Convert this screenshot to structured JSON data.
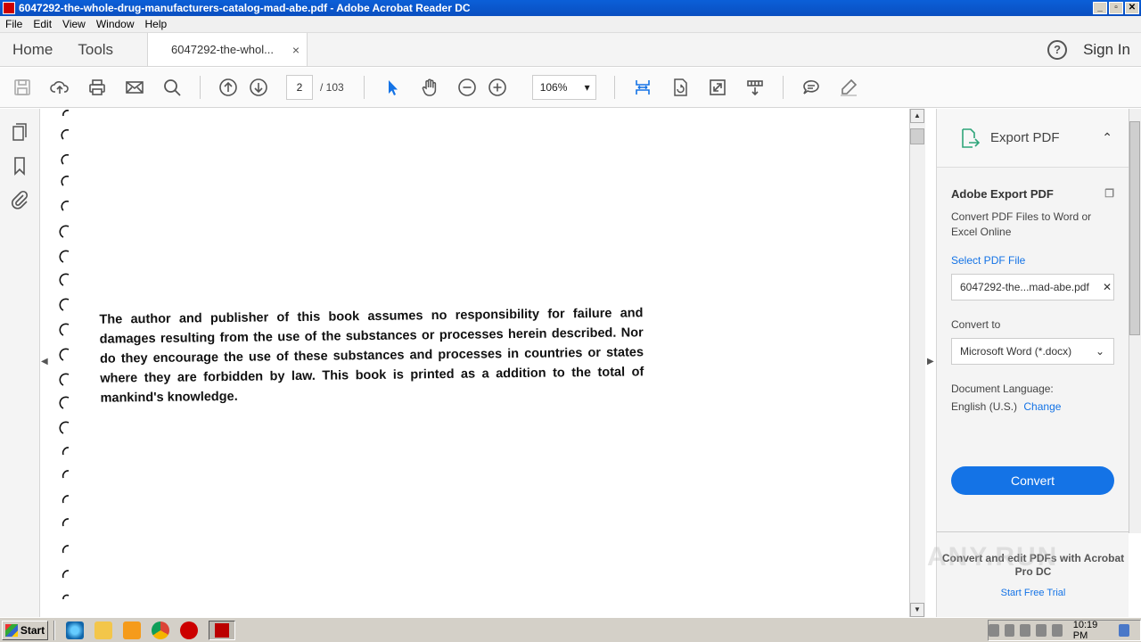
{
  "window": {
    "title": "6047292-the-whole-drug-manufacturers-catalog-mad-abe.pdf - Adobe Acrobat Reader DC",
    "minimize": "_",
    "maximize": "▫",
    "close": "✕"
  },
  "menu": [
    "File",
    "Edit",
    "View",
    "Window",
    "Help"
  ],
  "tabs": {
    "home": "Home",
    "tools": "Tools",
    "document": "6047292-the-whol...",
    "close": "×",
    "help": "?",
    "signin": "Sign In"
  },
  "toolbar": {
    "page_current": "2",
    "page_total": "/ 103",
    "zoom": "106%",
    "zoom_arrow": "▾"
  },
  "document": {
    "disclaimer": "The author and publisher of this book assumes no responsibility for failure and damages resulting from the use of the substances or processes herein described. Nor do they encourage the use of these substances and processes in countries or states where they are forbidden by law. This book is printed as a addition to the total of mankind's knowledge."
  },
  "export_panel": {
    "title": "Export PDF",
    "chevron": "⌃",
    "heading": "Adobe Export PDF",
    "description": "Convert PDF Files to Word or Excel Online",
    "select_link": "Select PDF File",
    "file_name": "6047292-the...mad-abe.pdf",
    "file_clear": "✕",
    "convert_to_label": "Convert to",
    "convert_to_value": "Microsoft Word (*.docx)",
    "convert_to_arrow": "⌄",
    "language_label": "Document Language:",
    "language_value": "English (U.S.)",
    "language_change": "Change",
    "convert_button": "Convert",
    "promo": "Convert and edit PDFs with Acrobat Pro DC",
    "trial_link": "Start Free Trial"
  },
  "taskbar": {
    "start": "Start",
    "clock": "10:19 PM"
  },
  "watermark": "ANY.RUN",
  "icons": {
    "save": "save-icon",
    "upload": "cloud-upload-icon",
    "print": "print-icon",
    "mail": "mail-icon",
    "search": "search-icon",
    "page_up": "arrow-up-icon",
    "page_down": "arrow-down-icon",
    "select": "pointer-icon",
    "hand": "hand-icon",
    "zoom_out": "zoom-out-icon",
    "zoom_in": "zoom-in-icon"
  },
  "colors": {
    "accent": "#1473e6",
    "titlebar": "#0b5fd8"
  }
}
